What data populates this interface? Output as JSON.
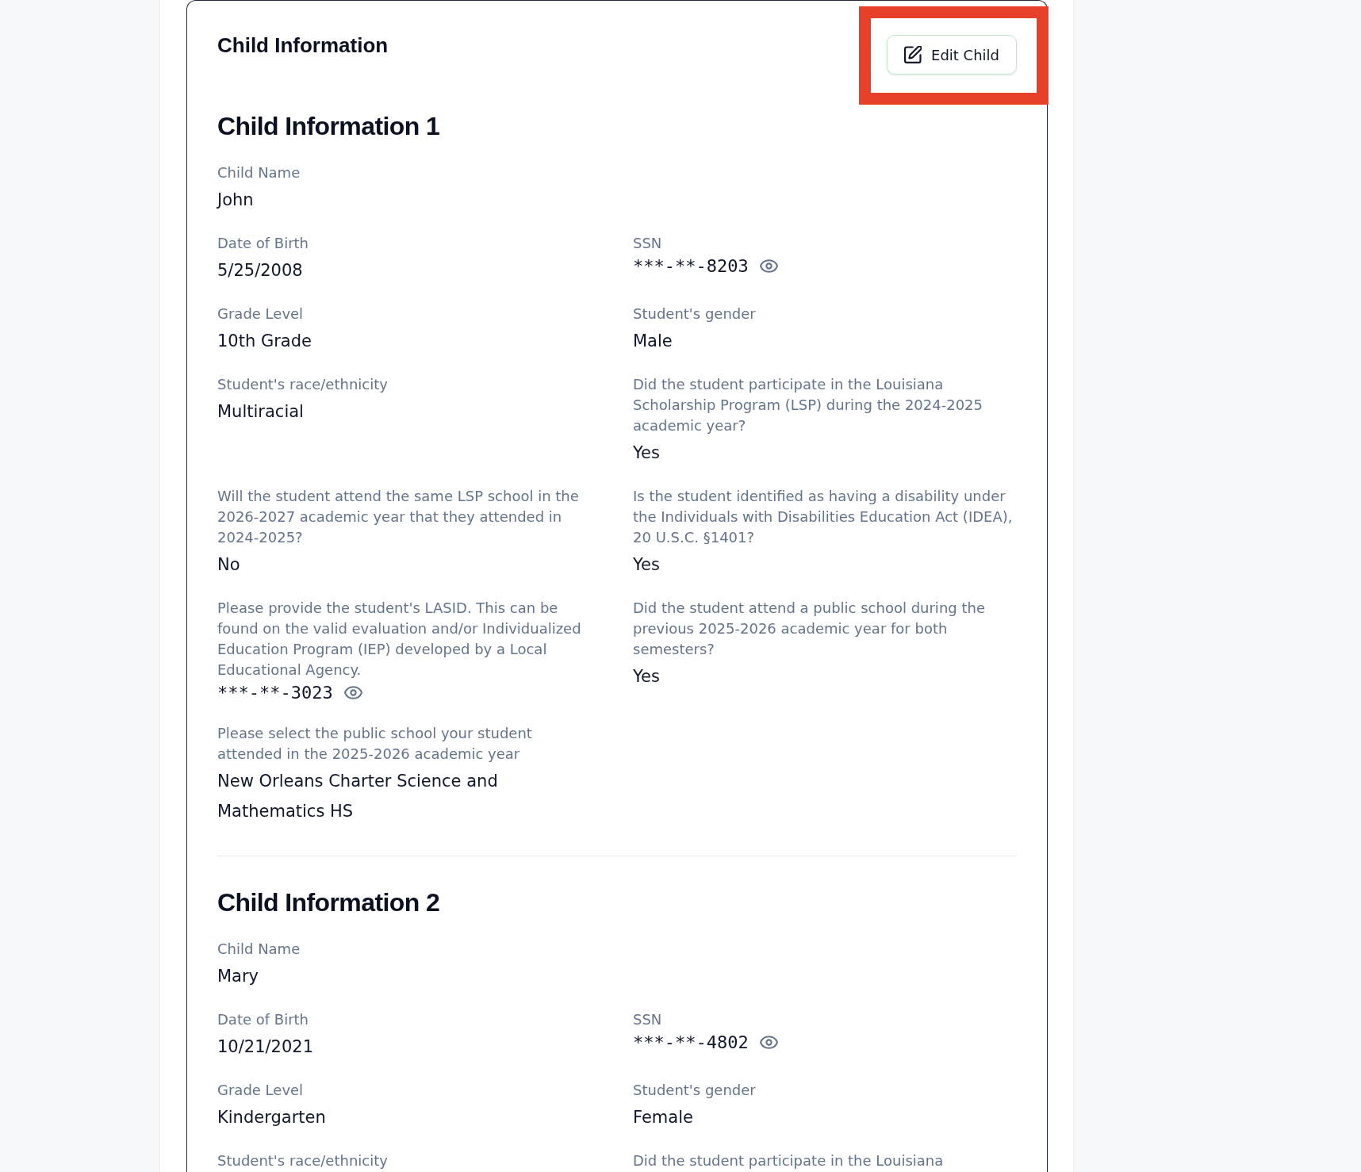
{
  "section": {
    "title": "Child Information",
    "edit_button": {
      "label": "Edit Child",
      "highlighted": true
    }
  },
  "children": [
    {
      "heading": "Child Information 1",
      "name": {
        "label": "Child Name",
        "value": "John"
      },
      "fields": [
        {
          "kind": "text",
          "label": "Date of Birth",
          "value": "5/25/2008"
        },
        {
          "kind": "masked",
          "label": "SSN",
          "value": "***-**-8203"
        },
        {
          "kind": "text",
          "label": "Grade Level",
          "value": "10th Grade"
        },
        {
          "kind": "text",
          "label": "Student's gender",
          "value": "Male"
        },
        {
          "kind": "text",
          "label": "Student's race/ethnicity",
          "value": "Multiracial"
        },
        {
          "kind": "text",
          "label": "Did the student participate in the Louisiana Scholarship Program (LSP) during the 2024-2025 academic year?",
          "value": "Yes"
        },
        {
          "kind": "text",
          "label": "Will the student attend the same LSP school in the 2026-2027 academic year that they attended in 2024-2025?",
          "value": "No"
        },
        {
          "kind": "text",
          "label": "Is the student identified as having a disability under the Individuals with Disabilities Education Act (IDEA), 20 U.S.C. §1401?",
          "value": "Yes"
        },
        {
          "kind": "masked",
          "label": "Please provide the student's LASID. This can be found on the valid evaluation and/or Individualized Education Program (IEP) developed by a Local Educational Agency.",
          "value": "***-**-3023"
        },
        {
          "kind": "text",
          "label": "Did the student attend a public school during the previous 2025-2026 academic year for both semesters?",
          "value": "Yes"
        },
        {
          "kind": "text",
          "label": "Please select the public school your student attended in the 2025-2026 academic year",
          "value": "New Orleans Charter Science and Mathematics HS"
        }
      ]
    },
    {
      "heading": "Child Information 2",
      "name": {
        "label": "Child Name",
        "value": "Mary"
      },
      "fields": [
        {
          "kind": "text",
          "label": "Date of Birth",
          "value": "10/21/2021"
        },
        {
          "kind": "masked",
          "label": "SSN",
          "value": "***-**-4802"
        },
        {
          "kind": "text",
          "label": "Grade Level",
          "value": "Kindergarten"
        },
        {
          "kind": "text",
          "label": "Student's gender",
          "value": "Female"
        },
        {
          "label": "Student's race/ethnicity"
        },
        {
          "label": "Did the student participate in the Louisiana"
        }
      ]
    }
  ]
}
